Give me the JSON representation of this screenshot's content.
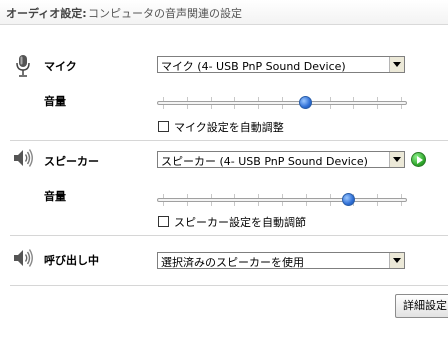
{
  "header": {
    "title": "オーディオ設定:",
    "description": "コンピュータの音声関連の設定"
  },
  "microphone": {
    "label": "マイク",
    "device": "マイク (4- USB PnP Sound Device)",
    "volume_label": "音量",
    "volume_level": 0.6,
    "auto_adjust_label": "マイク設定を自動調整",
    "auto_adjust_checked": false,
    "icon": "microphone-icon"
  },
  "speaker": {
    "label": "スピーカー",
    "device": "スピーカー (4- USB PnP Sound Device)",
    "volume_label": "音量",
    "volume_level": 0.78,
    "auto_adjust_label": "スピーカー設定を自動調節",
    "auto_adjust_checked": false,
    "icon": "speaker-icon",
    "test_icon": "play-icon"
  },
  "ringing": {
    "label": "呼び出し中",
    "device": "選択済みのスピーカーを使用",
    "icon": "speaker-icon"
  },
  "advanced_button": {
    "label": "詳細設定"
  },
  "colors": {
    "slider_thumb": "#2f6fd6",
    "play_button": "#2ea62b"
  }
}
